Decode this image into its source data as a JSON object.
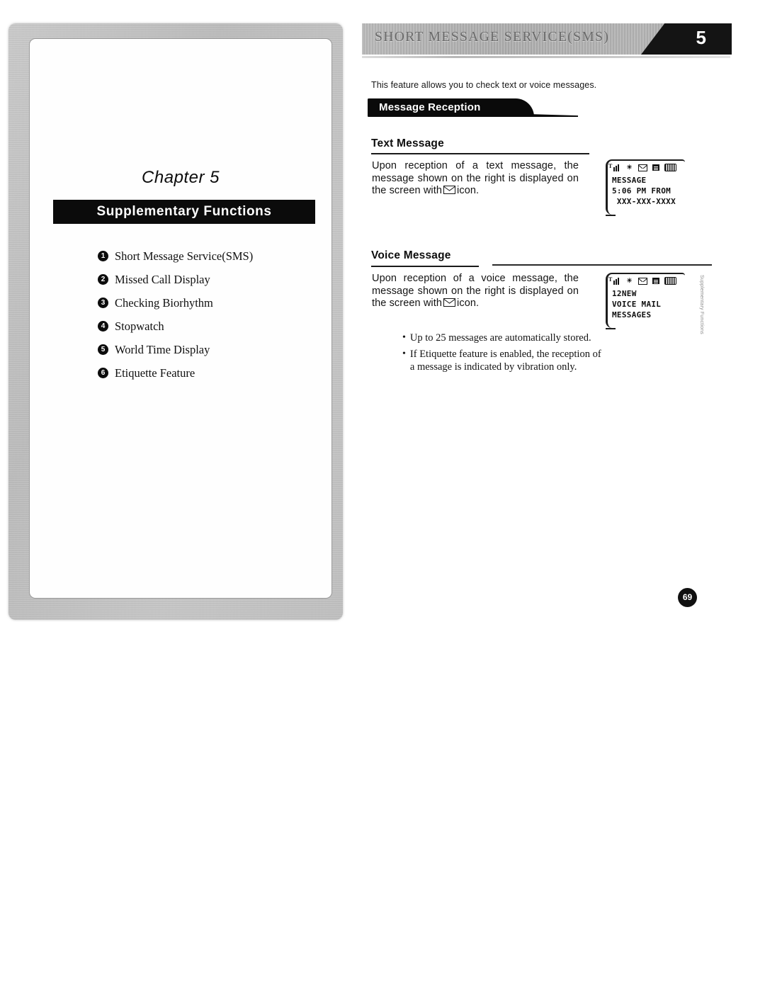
{
  "left_page": {
    "chapter_label": "Chapter 5",
    "chapter_title": "Supplementary Functions",
    "contents": [
      {
        "num": "1",
        "label": "Short Message Service(SMS)"
      },
      {
        "num": "2",
        "label": "Missed Call Display"
      },
      {
        "num": "3",
        "label": "Checking Biorhythm"
      },
      {
        "num": "4",
        "label": "Stopwatch"
      },
      {
        "num": "5",
        "label": "World Time Display"
      },
      {
        "num": "6",
        "label": "Etiquette Feature"
      }
    ]
  },
  "right_page": {
    "header": {
      "title": "SHORT MESSAGE SERVICE(SMS)",
      "chapter_number": "5"
    },
    "intro": "This feature allows you to check text or voice messages.",
    "section_banner": "Message Reception",
    "text_message": {
      "heading": "Text Message",
      "body_before_icon": "Upon reception of a text message, the message shown on the right is displayed on the screen with",
      "body_after_icon": "icon.",
      "lcd": {
        "line1": "MESSAGE",
        "line2": "5:06 PM FROM",
        "line3": " XXX-XXX-XXXX",
        "status_icons": [
          "signal-bars-icon",
          "roaming-icon",
          "envelope-icon",
          "battery-box-icon",
          "battery-icon"
        ]
      }
    },
    "voice_message": {
      "heading": "Voice Message",
      "body_before_icon": "Upon reception of a voice message, the message shown on the right is displayed on the screen with",
      "body_after_icon": "icon.",
      "lcd": {
        "line1": "12NEW",
        "line2": "VOICE MAIL",
        "line3": "MESSAGES",
        "status_icons": [
          "signal-bars-icon",
          "roaming-icon",
          "envelope-icon",
          "battery-box-icon",
          "battery-icon"
        ]
      }
    },
    "notes": [
      "Up to 25 messages are automatically stored.",
      "If Etiquette feature is enabled, the reception of a message is indicated by vibration only."
    ],
    "side_note": "Supplementary Functions",
    "page_number": "69"
  },
  "colors": {
    "ink": "#0d0d0d",
    "banner_bg": "#0a0a0a",
    "header_gray": "#b0b0b0",
    "paper": "#ffffff"
  }
}
